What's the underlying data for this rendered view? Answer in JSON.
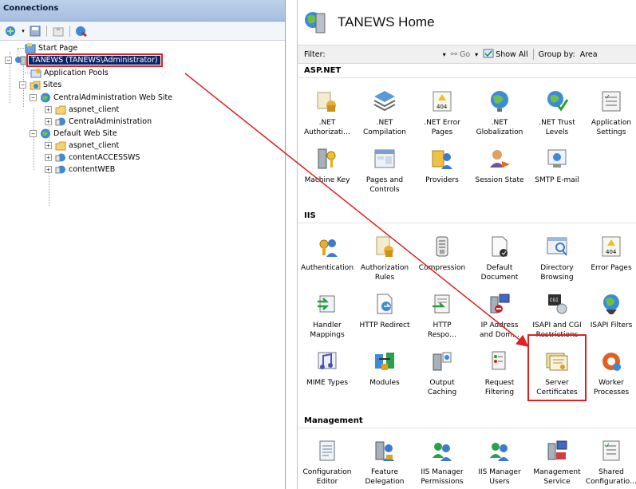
{
  "connections": {
    "header": "Connections",
    "toolbar": [
      "connect-icon",
      "save-icon",
      "up-icon",
      "refresh-icon"
    ],
    "tree": [
      {
        "label": "Start Page",
        "expander": "",
        "icon": "start-page-icon"
      },
      {
        "label": "TANEWS (TANEWS\\Administrator)",
        "expander": "−",
        "icon": "server-icon",
        "selected": true
      },
      {
        "label": "Application Pools",
        "expander": "",
        "icon": "app-pools-icon"
      },
      {
        "label": "Sites",
        "expander": "−",
        "icon": "folder-icon"
      },
      {
        "label": "CentralAdministration Web Site",
        "expander": "−",
        "icon": "globe-icon"
      },
      {
        "label": "aspnet_client",
        "expander": "+",
        "icon": "folder-icon"
      },
      {
        "label": "CentralAdministration",
        "expander": "+",
        "icon": "app-icon"
      },
      {
        "label": "Default Web Site",
        "expander": "−",
        "icon": "globe-icon"
      },
      {
        "label": "aspnet_client",
        "expander": "+",
        "icon": "folder-icon"
      },
      {
        "label": "contentACCESSWS",
        "expander": "+",
        "icon": "app-icon"
      },
      {
        "label": "contentWEB",
        "expander": "+",
        "icon": "app-icon"
      }
    ]
  },
  "main": {
    "title": "TANEWS Home",
    "filter_label": "Filter:",
    "go_label": "Go",
    "show_all_label": "Show All",
    "group_by_label": "Group by:",
    "group_by_value": "Area"
  },
  "sections": [
    {
      "name": "ASP.NET",
      "rows": [
        [
          "NET Authorization",
          ".NET Compilation",
          ".NET Error Pages",
          ".NET Globalization",
          ".NET Trust Levels",
          "Application Settings"
        ],
        [
          "Machine Key",
          "Pages and Controls",
          "Providers",
          "Session State",
          "SMTP E-mail"
        ]
      ],
      "labels": [
        [
          ".NET\nAuthorizati…",
          ".NET\nCompilation",
          ".NET Error\nPages",
          ".NET\nGlobalization",
          ".NET Trust\nLevels",
          "Application\nSettings"
        ],
        [
          "Machine Key",
          "Pages and\nControls",
          "Providers",
          "Session State",
          "SMTP E-mail"
        ]
      ]
    },
    {
      "name": "IIS",
      "labels": [
        [
          "Authentication",
          "Authorization\nRules",
          "Compression",
          "Default\nDocument",
          "Directory\nBrowsing",
          "Error Pages"
        ],
        [
          "Handler\nMappings",
          "HTTP Redirect",
          "HTTP\nRespo…",
          "IP Address\nand Dom…",
          "ISAPI and CGI\nRestrictions",
          "ISAPI Filters"
        ],
        [
          "MIME Types",
          "Modules",
          "Output\nCaching",
          "Request\nFiltering",
          "Server\nCertificates",
          "Worker\nProcesses"
        ]
      ]
    },
    {
      "name": "Management",
      "labels": [
        [
          "Configuration\nEditor",
          "Feature\nDelegation",
          "IIS Manager\nPermissions",
          "IIS Manager\nUsers",
          "Management\nService",
          "Shared\nConfiguratio…"
        ]
      ]
    }
  ],
  "highlight": {
    "feature": "Server Certificates",
    "color": "#e02020"
  },
  "colors": {
    "selection": "#0a246a",
    "annotation": "#e02020",
    "header_bg": "#a6bedf"
  }
}
